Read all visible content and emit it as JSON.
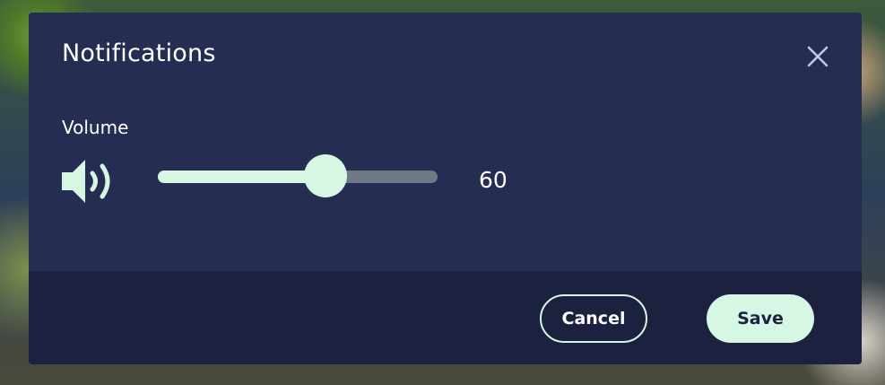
{
  "dialog": {
    "title": "Notifications",
    "close_icon": "close-icon"
  },
  "volume": {
    "label": "Volume",
    "icon": "speaker-volume-icon",
    "value": 60,
    "value_text": "60",
    "max": 100
  },
  "footer": {
    "cancel_label": "Cancel",
    "save_label": "Save"
  },
  "colors": {
    "dialog_bg": "#262d52",
    "footer_bg": "#1c2140",
    "accent": "#d7f7e5",
    "track": "#6e7a86",
    "text": "#ffffff"
  }
}
